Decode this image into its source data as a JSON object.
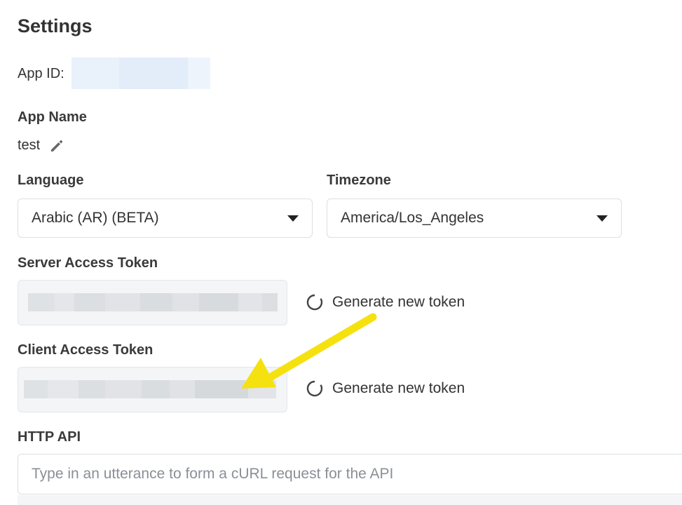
{
  "page": {
    "title": "Settings"
  },
  "app_id": {
    "label": "App ID:",
    "value_redacted": true
  },
  "app_name": {
    "label": "App Name",
    "value": "test",
    "edit_icon": "pencil-icon"
  },
  "language": {
    "label": "Language",
    "selected": "Arabic (AR) (BETA)",
    "icon": "caret-down-icon"
  },
  "timezone": {
    "label": "Timezone",
    "selected": "America/Los_Angeles",
    "icon": "caret-down-icon"
  },
  "server_token": {
    "label": "Server Access Token",
    "value_redacted": true,
    "action_label": "Generate new token",
    "action_icon": "refresh-icon"
  },
  "client_token": {
    "label": "Client Access Token",
    "value_redacted": true,
    "action_label": "Generate new token",
    "action_icon": "refresh-icon"
  },
  "http_api": {
    "label": "HTTP API",
    "placeholder": "Type in an utterance to form a cURL request for the API",
    "value": ""
  },
  "annotation": {
    "type": "arrow",
    "color": "#f5e10f",
    "points_to": "client_token"
  }
}
